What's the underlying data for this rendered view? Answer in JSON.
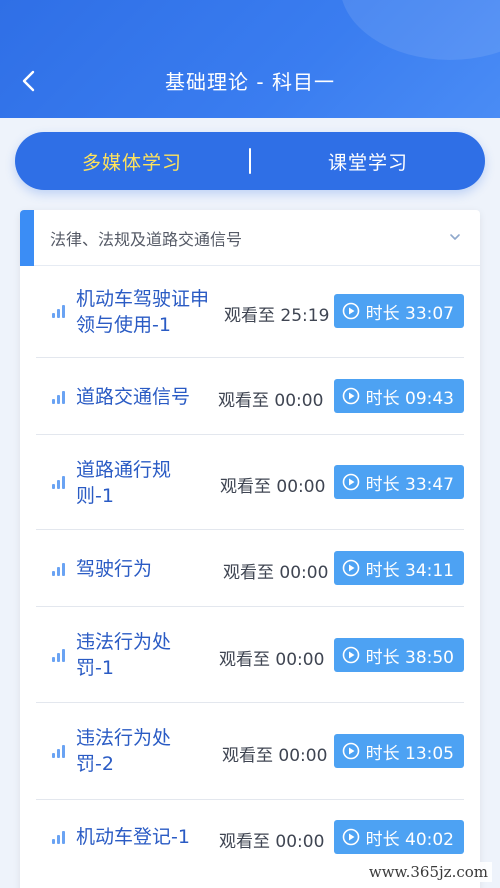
{
  "header": {
    "title": "基础理论 - 科目一",
    "back_icon": "chevron-left-icon"
  },
  "tabs": [
    {
      "label": "多媒体学习",
      "active": true
    },
    {
      "label": "课堂学习",
      "active": false
    }
  ],
  "section": {
    "title": "法律、法规及道路交通信号",
    "toggle_icon": "chevron-down-icon"
  },
  "lessons": [
    {
      "title": "机动车驾驶证申领与使用-1",
      "watched": "观看至 25:19",
      "duration": "时长 33:07"
    },
    {
      "title": "道路交通信号",
      "watched": "观看至 00:00",
      "duration": "时长 09:43"
    },
    {
      "title": "道路通行规则-1",
      "watched": "观看至 00:00",
      "duration": "时长 33:47"
    },
    {
      "title": "驾驶行为",
      "watched": "观看至 00:00",
      "duration": "时长 34:11"
    },
    {
      "title": "违法行为处罚-1",
      "watched": "观看至 00:00",
      "duration": "时长 38:50"
    },
    {
      "title": "违法行为处罚-2",
      "watched": "观看至 00:00",
      "duration": "时长 13:05"
    },
    {
      "title": "机动车登记-1",
      "watched": "观看至 00:00",
      "duration": "时长 40:02"
    }
  ],
  "watermark": "www.365jz.com",
  "colors": {
    "primary": "#2f6fe6",
    "active_tab_text": "#ffe35c",
    "duration_button": "#4da2f3",
    "lesson_title": "#2a5bc4"
  }
}
